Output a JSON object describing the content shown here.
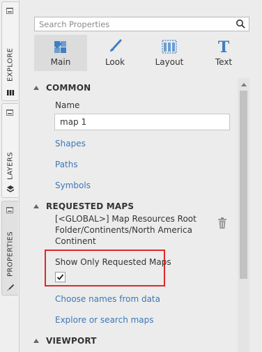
{
  "side_tabs": [
    {
      "label": "EXPLORE",
      "icon": "data-sources-icon"
    },
    {
      "label": "LAYERS",
      "icon": "layers-icon"
    },
    {
      "label": "PROPERTIES",
      "icon": "brush-icon"
    }
  ],
  "search": {
    "placeholder": "Search Properties"
  },
  "tabs": [
    {
      "label": "Main",
      "icon": "puzzle-icon"
    },
    {
      "label": "Look",
      "icon": "paintbrush-icon"
    },
    {
      "label": "Layout",
      "icon": "layout-grid-icon"
    },
    {
      "label": "Text",
      "icon": "text-T-icon"
    }
  ],
  "sections": {
    "common": {
      "title": "COMMON",
      "name_label": "Name",
      "name_value": "map 1",
      "links": [
        "Shapes",
        "Paths",
        "Symbols"
      ]
    },
    "requested_maps": {
      "title": "REQUESTED MAPS",
      "map_path": "[<GLOBAL>] Map Resources Root Folder/Continents/North America Continent",
      "show_only_label": "Show Only Requested Maps",
      "show_only_checked": true,
      "links": [
        "Choose names from data",
        "Explore or search maps"
      ]
    },
    "viewport": {
      "title": "VIEWPORT"
    }
  },
  "colors": {
    "link": "#3a78b7",
    "highlight": "#e02828",
    "tab_active": "#dcdcdc"
  }
}
